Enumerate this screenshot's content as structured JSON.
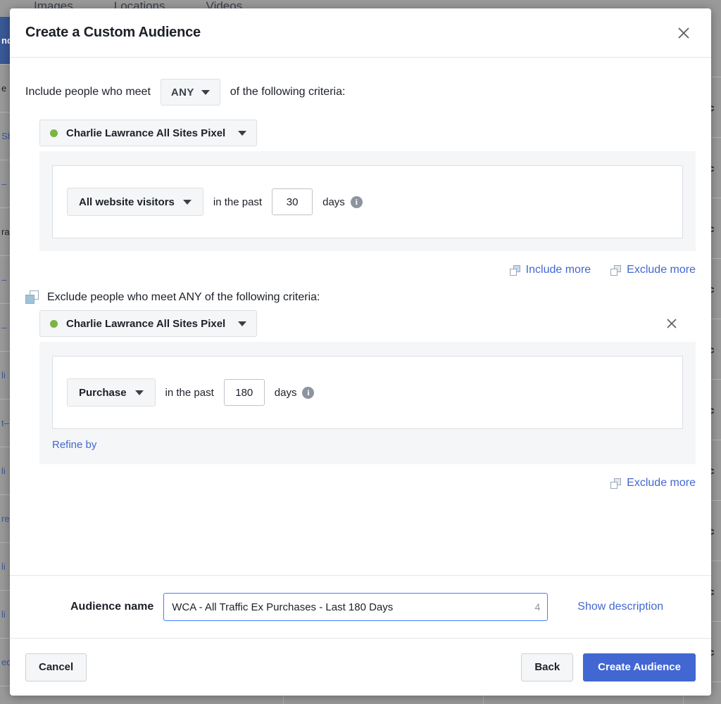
{
  "background": {
    "topnav": [
      "Images",
      "Locations",
      "Videos"
    ],
    "left_fragments": [
      {
        "text": "nd",
        "selected": true,
        "link": false
      },
      {
        "text": "e",
        "selected": false,
        "link": false
      },
      {
        "text": "Sh",
        "selected": false,
        "link": true
      },
      {
        "text": "–",
        "selected": false,
        "link": true
      },
      {
        "text": "ra",
        "selected": false,
        "link": false
      },
      {
        "text": "–",
        "selected": false,
        "link": true
      },
      {
        "text": "–",
        "selected": false,
        "link": true
      },
      {
        "text": "li",
        "selected": false,
        "link": true
      },
      {
        "text": "t–",
        "selected": false,
        "link": true
      },
      {
        "text": "li",
        "selected": false,
        "link": true
      },
      {
        "text": "re",
        "selected": false,
        "link": true
      },
      {
        "text": "li",
        "selected": false,
        "link": true
      },
      {
        "text": "li",
        "selected": false,
        "link": true
      },
      {
        "text": "ed",
        "selected": false,
        "link": true
      }
    ],
    "right_fragments": [
      "a",
      "ac",
      "ac",
      "ac",
      "ac",
      "ac",
      "ac",
      "ac",
      "ac",
      "ac",
      "ac"
    ]
  },
  "modal": {
    "title": "Create a Custom Audience",
    "close_icon": "close-icon",
    "include": {
      "prefix": "Include people who meet",
      "match_value": "ANY",
      "suffix": "of the following criteria:",
      "source": {
        "name": "Charlie Lawrance All Sites Pixel",
        "status_color": "#7cb342"
      },
      "rule": {
        "event": "All website visitors",
        "between_text": "in the past",
        "days": "30",
        "days_label": "days",
        "info_icon": "info-icon"
      }
    },
    "links": {
      "include_more": "Include more",
      "exclude_more": "Exclude more"
    },
    "exclude": {
      "heading": "Exclude people who meet ANY of the following criteria:",
      "source": {
        "name": "Charlie Lawrance All Sites Pixel",
        "status_color": "#7cb342"
      },
      "remove_icon": "close-icon",
      "rule": {
        "event": "Purchase",
        "between_text": "in the past",
        "days": "180",
        "days_label": "days",
        "info_icon": "info-icon"
      },
      "refine_by": "Refine by",
      "exclude_more": "Exclude more"
    },
    "name_section": {
      "label": "Audience name",
      "value": "WCA - All Traffic Ex Purchases - Last 180 Days",
      "placeholder": "Audience name",
      "counter": "4",
      "show_description": "Show description"
    },
    "footer": {
      "cancel": "Cancel",
      "back": "Back",
      "create": "Create Audience",
      "primary_color": "#4267d2"
    }
  }
}
